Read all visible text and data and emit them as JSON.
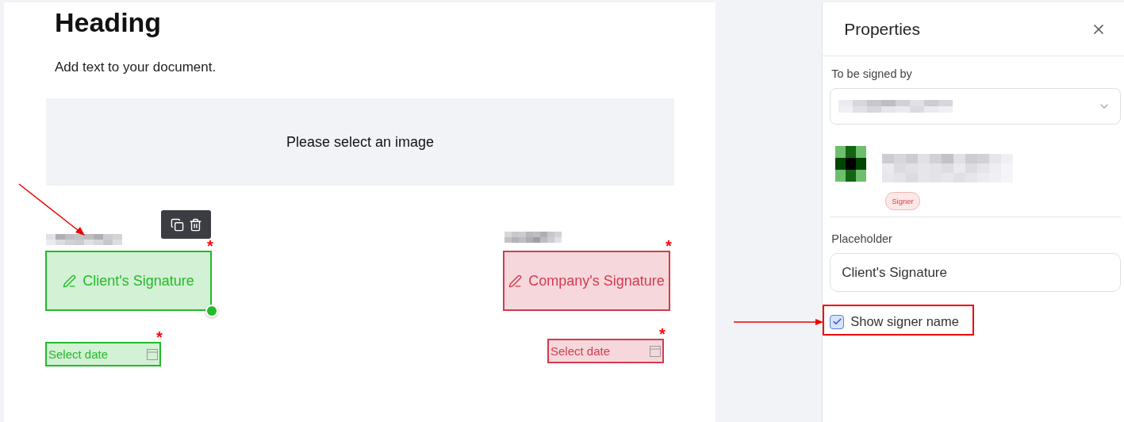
{
  "document": {
    "heading": "Heading",
    "body": "Add text to your document.",
    "image_placeholder": "Please select an image"
  },
  "fields": [
    {
      "kind": "signature",
      "label": "Client's Signature",
      "color": "#22bb2a",
      "selected": true,
      "required": true
    },
    {
      "kind": "signature",
      "label": "Company's Signature",
      "color": "#d43a50",
      "selected": false,
      "required": true
    },
    {
      "kind": "date",
      "label": "Select date",
      "color": "#22bb2a",
      "selected": false,
      "required": true
    },
    {
      "kind": "date",
      "label": "Select date",
      "color": "#d43a50",
      "selected": false,
      "required": true
    }
  ],
  "required_mark": "*",
  "properties": {
    "title": "Properties",
    "signed_by_label": "To be signed by",
    "role_badge": "Signer",
    "placeholder_label": "Placeholder",
    "placeholder_input": {
      "value": "Client's Signature"
    },
    "show_signer_name": {
      "label": "Show signer name",
      "checked": true
    }
  }
}
